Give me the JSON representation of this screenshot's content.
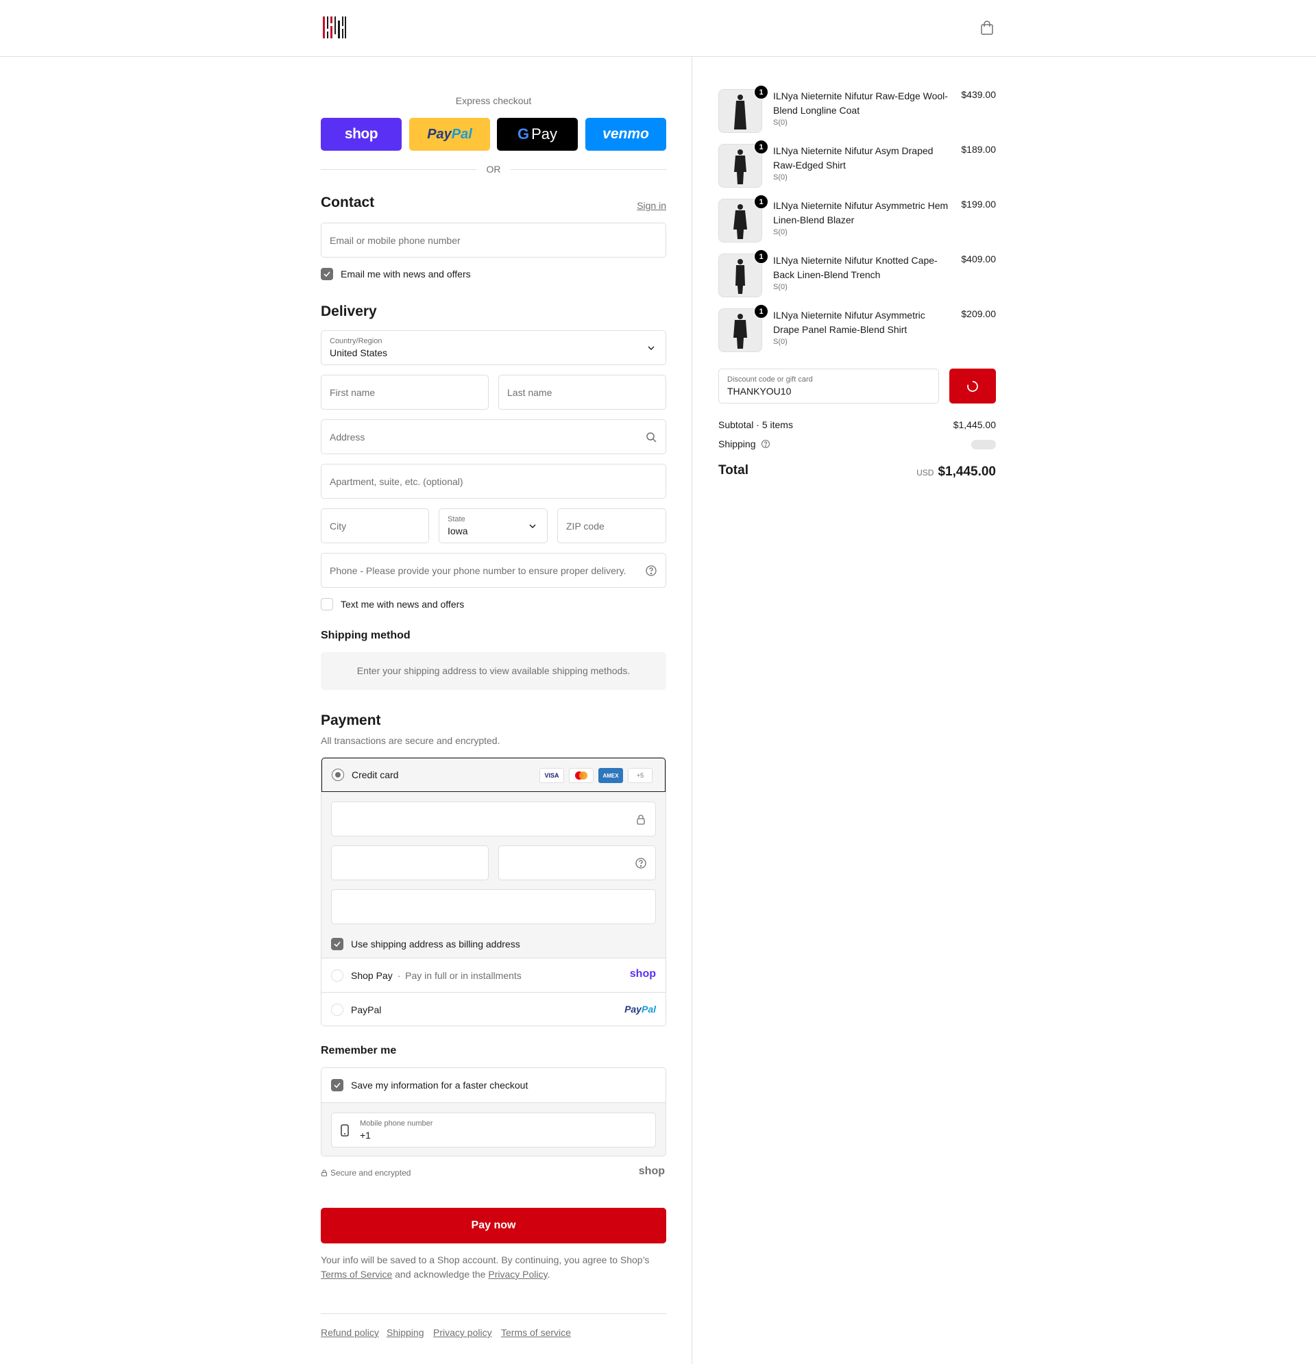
{
  "header": {
    "logo": "store-logo",
    "cart_icon": "shopping-bag-icon"
  },
  "express": {
    "title": "Express checkout",
    "buttons": {
      "shop": "shop",
      "paypal_a": "Pay",
      "paypal_b": "Pal",
      "gpay_g": "G",
      "gpay_text": "Pay",
      "venmo": "venmo"
    },
    "or": "OR"
  },
  "contact": {
    "heading": "Contact",
    "sign_in": "Sign in",
    "email_placeholder": "Email or mobile phone number",
    "email_news": "Email me with news and offers"
  },
  "delivery": {
    "heading": "Delivery",
    "country_label": "Country/Region",
    "country_value": "United States",
    "first_name": "First name",
    "last_name": "Last name",
    "address": "Address",
    "apartment": "Apartment, suite, etc. (optional)",
    "city": "City",
    "state_label": "State",
    "state_value": "Iowa",
    "zip": "ZIP code",
    "phone": "Phone - Please provide your phone number to ensure proper delivery.",
    "text_news": "Text me with news and offers"
  },
  "shipping_method": {
    "heading": "Shipping method",
    "message": "Enter your shipping address to view available shipping methods."
  },
  "payment": {
    "heading": "Payment",
    "subtitle": "All transactions are secure and encrypted.",
    "credit_card": "Credit card",
    "card_logos": {
      "visa": "VISA",
      "amex": "AMEX",
      "more": "+5"
    },
    "billing_same": "Use shipping address as billing address",
    "shop_pay": "Shop Pay",
    "shop_pay_sep": "·",
    "shop_pay_desc": "Pay in full or in installments",
    "shop_pay_logo": "shop",
    "paypal": "PayPal",
    "paypal_logo_a": "Pay",
    "paypal_logo_b": "Pal"
  },
  "remember": {
    "heading": "Remember me",
    "save_info": "Save my information for a faster checkout",
    "mobile_label": "Mobile phone number",
    "mobile_value": "+1",
    "secure": "Secure and encrypted",
    "shop_logo": "shop"
  },
  "pay_now": "Pay now",
  "legal": {
    "text_a": "Your info will be saved to a Shop account. By continuing, you agree to Shop’s",
    "terms": "Terms of Service",
    "text_b": "and acknowledge the",
    "privacy": "Privacy Policy",
    "period": "."
  },
  "footer": {
    "links": [
      "Refund policy",
      "Shipping",
      "Privacy policy",
      "Terms of service"
    ]
  },
  "summary": {
    "items": [
      {
        "qty": "1",
        "name": "ILNya Nieternite Nifutur Raw-Edge Wool-Blend Longline Coat",
        "variant": "S(0)",
        "price": "$439.00"
      },
      {
        "qty": "1",
        "name": "ILNya Nieternite Nifutur Asym Draped Raw-Edged Shirt",
        "variant": "S(0)",
        "price": "$189.00"
      },
      {
        "qty": "1",
        "name": "ILNya Nieternite Nifutur Asymmetric Hem Linen-Blend Blazer",
        "variant": "S(0)",
        "price": "$199.00"
      },
      {
        "qty": "1",
        "name": "ILNya Nieternite Nifutur Knotted Cape-Back Linen-Blend Trench",
        "variant": "S(0)",
        "price": "$409.00"
      },
      {
        "qty": "1",
        "name": "ILNya Nieternite Nifutur Asymmetric Drape Panel Ramie-Blend Shirt",
        "variant": "S(0)",
        "price": "$209.00"
      }
    ],
    "discount_label": "Discount code or gift card",
    "discount_value": "THANKYOU10",
    "subtotal_label": "Subtotal · 5 items",
    "subtotal_value": "$1,445.00",
    "shipping_label": "Shipping",
    "total_label": "Total",
    "currency": "USD",
    "total_value": "$1,445.00"
  },
  "colors": {
    "accent": "#d0000f",
    "shop": "#5a31f4",
    "paypal": "#ffc439",
    "venmo": "#008cff"
  }
}
